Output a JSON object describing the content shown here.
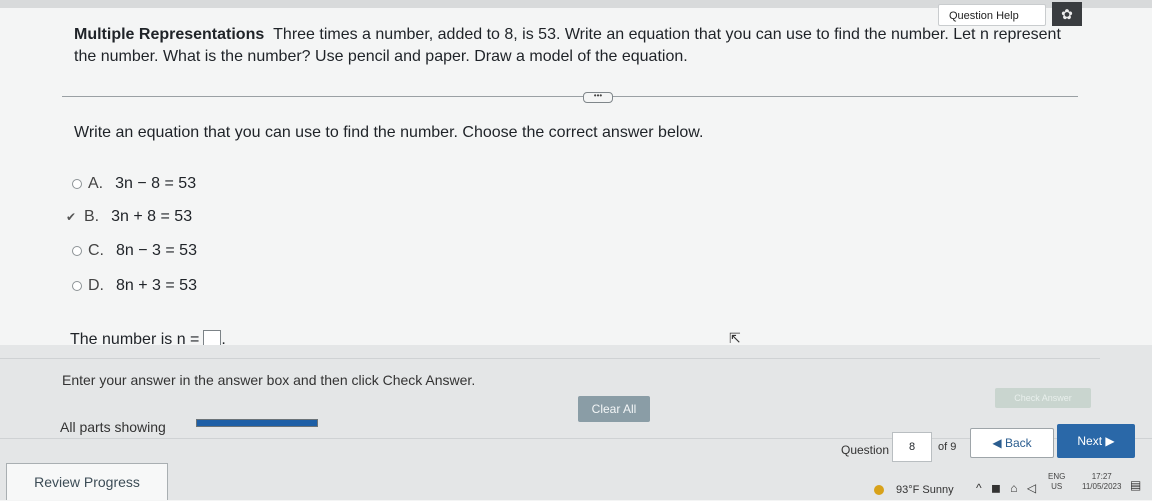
{
  "header": {
    "help_label": "Question Help",
    "settings_icon": "gear-icon"
  },
  "problem": {
    "title": "Multiple Representations",
    "text": "Three times a number, added to 8, is 53. Write an equation that you can use to find the number. Let n represent the number. What is the number? Use pencil and paper. Draw a model of the equation."
  },
  "divider": {
    "more_label": "•••"
  },
  "part": {
    "instruction": "Write an equation that you can use to find the number. Choose the correct answer below.",
    "options": [
      {
        "letter": "A.",
        "equation": "3n − 8 = 53"
      },
      {
        "letter": "B.",
        "equation": "3n + 8 = 53"
      },
      {
        "letter": "C.",
        "equation": "8n − 3 = 53"
      },
      {
        "letter": "D.",
        "equation": "8n + 3 = 53"
      }
    ],
    "selected": "B.",
    "answer_prompt": "The number is n =",
    "answer_value": "",
    "answer_suffix": "."
  },
  "footer": {
    "enter_text": "Enter your answer in the answer box and then click Check Answer.",
    "check_answer_label": "Check Answer",
    "clear_all_label": "Clear All",
    "parts_label": "All parts showing",
    "progress_fraction": 1.0,
    "question_label": "Question",
    "question_number": "8",
    "question_of": "of 9",
    "back_label": "◀ Back",
    "next_label": "Next ▶",
    "review_label": "Review Progress"
  },
  "taskbar": {
    "weather": "93°F Sunny",
    "tray": "^ ◼ ⌂ ◁",
    "lang_top": "ENG",
    "lang_bottom": "US",
    "time": "17:27",
    "date": "11/05/2023"
  }
}
